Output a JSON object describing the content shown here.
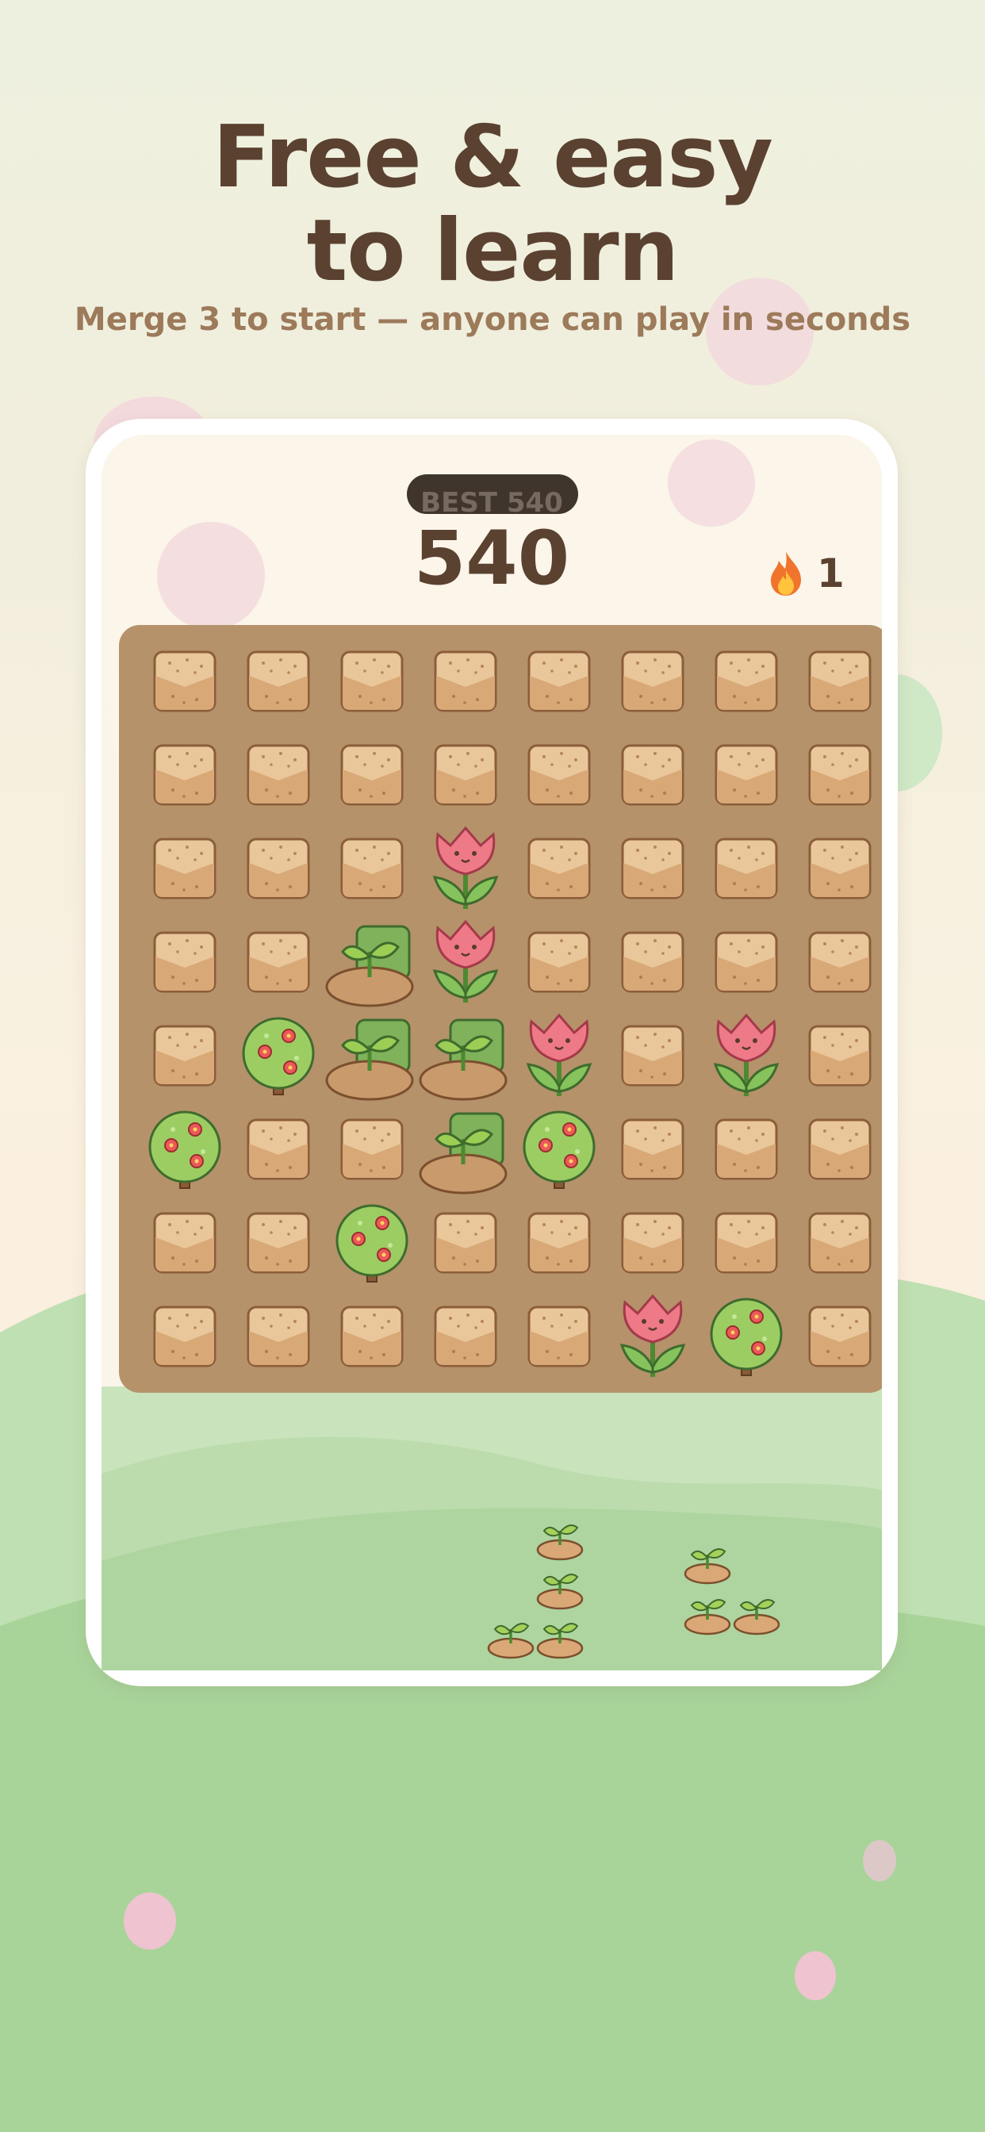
{
  "headline": {
    "line1": "Free & easy",
    "line2": "to learn"
  },
  "subtitle": "Merge 3 to start — anyone can play in seconds",
  "game": {
    "best_label": "BEST 540",
    "score": "540",
    "streak_icon": "flame-icon",
    "streak_count": "1"
  },
  "board": {
    "rows": 8,
    "cols": 8,
    "tiles": [
      [
        "soil",
        "soil",
        "soil",
        "soil",
        "soil",
        "soil",
        "soil",
        "soil"
      ],
      [
        "soil",
        "soil",
        "soil",
        "soil",
        "soil",
        "soil",
        "soil",
        "soil"
      ],
      [
        "soil",
        "soil",
        "soil",
        "tulip",
        "soil",
        "soil",
        "soil",
        "soil"
      ],
      [
        "soil",
        "soil",
        "sprout",
        "tulip",
        "soil",
        "soil",
        "soil",
        "soil"
      ],
      [
        "soil",
        "bush",
        "sprout",
        "sprout",
        "tulip",
        "soil",
        "tulip",
        "soil"
      ],
      [
        "bush",
        "soil",
        "soil",
        "sprout",
        "bush",
        "soil",
        "soil",
        "soil"
      ],
      [
        "soil",
        "soil",
        "bush",
        "soil",
        "soil",
        "soil",
        "soil",
        "soil"
      ],
      [
        "soil",
        "soil",
        "soil",
        "soil",
        "soil",
        "tulip",
        "bush",
        "soil"
      ]
    ]
  },
  "tray": {
    "pieces": [
      {
        "tile": "sprout",
        "count": 4
      },
      {
        "tile": "sprout",
        "count": 3
      }
    ]
  },
  "colors": {
    "background": "#eef0df",
    "board": "#b5926a",
    "headline": "#5b4130",
    "subtitle": "#9c7a5a",
    "grass": "#a7d398"
  }
}
